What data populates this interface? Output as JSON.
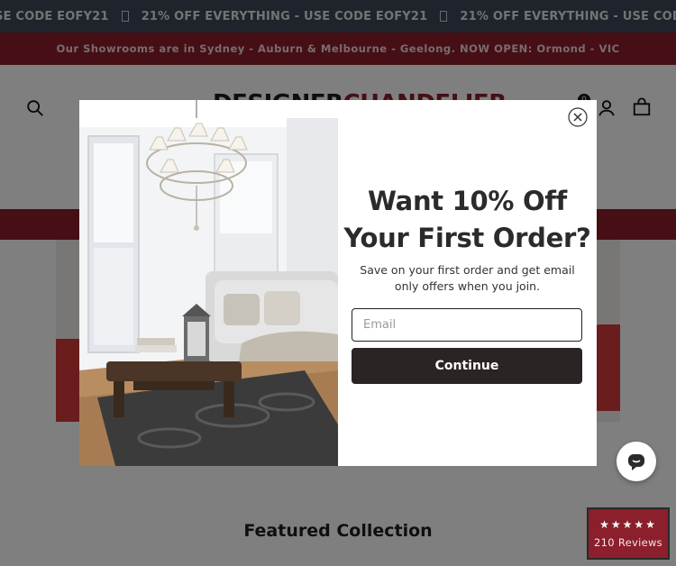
{
  "announcement": {
    "segments": [
      "SE CODE EOFY21",
      "21% OFF EVERYTHING - USE CODE EOFY21",
      "21% OFF EVERYTHING - USE CODE EOFY21",
      "21"
    ]
  },
  "showroom_bar": {
    "text": "Our Showrooms are in Sydney - Auburn & Melbourne - Geelong. NOW OPEN: Ormond - VIC"
  },
  "header": {
    "logo_part1": "DESIGNER",
    "logo_part2": "CHANDELIER",
    "cart_count": "0",
    "icons": [
      "search-icon",
      "account-icon",
      "cart-icon"
    ]
  },
  "modal": {
    "headline_line1": "Want 10% Off",
    "headline_line2": "Your First Order?",
    "subtext": "Save on your first order and get email only offers when you join.",
    "email_placeholder": "Email",
    "email_value": "",
    "continue_label": "Continue"
  },
  "featured": {
    "title": "Featured Collection"
  },
  "reviews_badge": {
    "stars": "★★★★★",
    "rating": 4.5,
    "count_label": "210 Reviews"
  },
  "colors": {
    "brand_red": "#8b1f2b",
    "marquee_bg": "#3f4758",
    "button_dark": "#2b2424"
  }
}
